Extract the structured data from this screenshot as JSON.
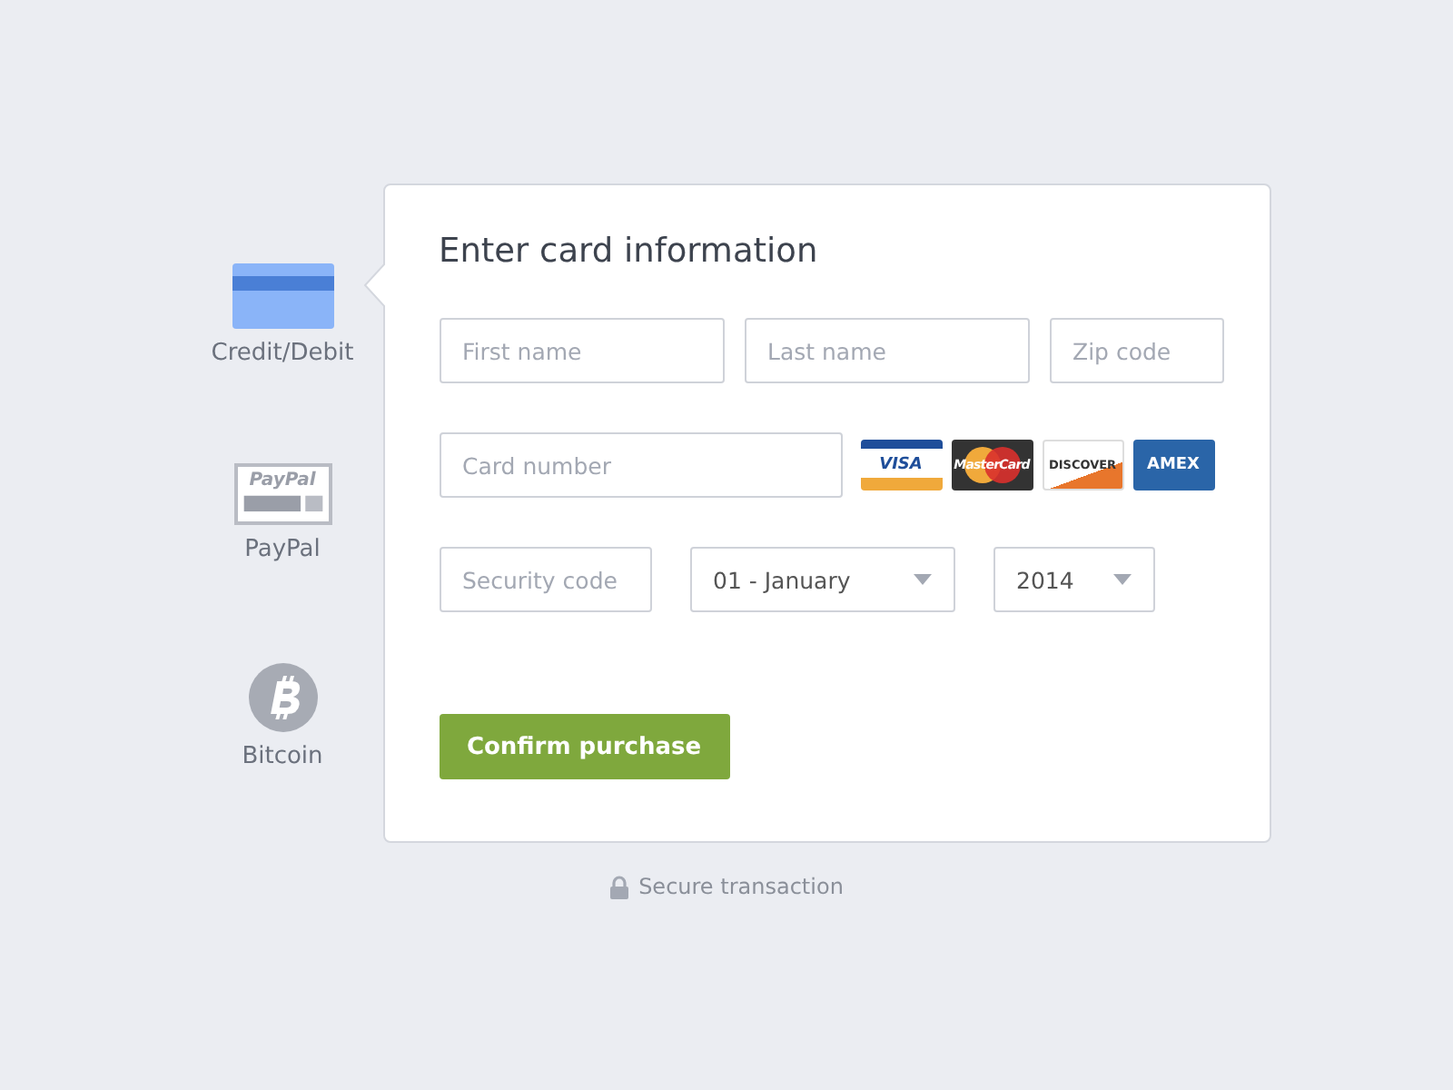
{
  "payment_methods": [
    {
      "kind": "card",
      "label": "Credit/Debit",
      "selected": true
    },
    {
      "kind": "paypal",
      "label": "PayPal",
      "logo_text": "PayPal",
      "selected": false
    },
    {
      "kind": "bitcoin",
      "label": "Bitcoin",
      "selected": false
    }
  ],
  "form": {
    "title": "Enter card information",
    "rows": [
      [
        {
          "kind": "input",
          "placeholder": "First name"
        },
        {
          "kind": "input",
          "placeholder": "Last name"
        },
        {
          "kind": "input",
          "placeholder": "Zip code"
        }
      ],
      [
        {
          "kind": "input",
          "placeholder": "Card number"
        },
        {
          "kind": "logos"
        }
      ],
      [
        {
          "kind": "input",
          "placeholder": "Security code"
        },
        {
          "kind": "select",
          "value": "01 - January"
        },
        {
          "kind": "select",
          "value": "2014"
        }
      ]
    ],
    "card_logos": [
      {
        "kind": "visa",
        "text": "VISA"
      },
      {
        "kind": "mastercard",
        "text": "MasterCard"
      },
      {
        "kind": "discover",
        "text": "DISCOVER"
      },
      {
        "kind": "amex",
        "text": "AMEX"
      }
    ],
    "confirm_button": "Confirm purchase"
  },
  "footer": "Secure transaction"
}
